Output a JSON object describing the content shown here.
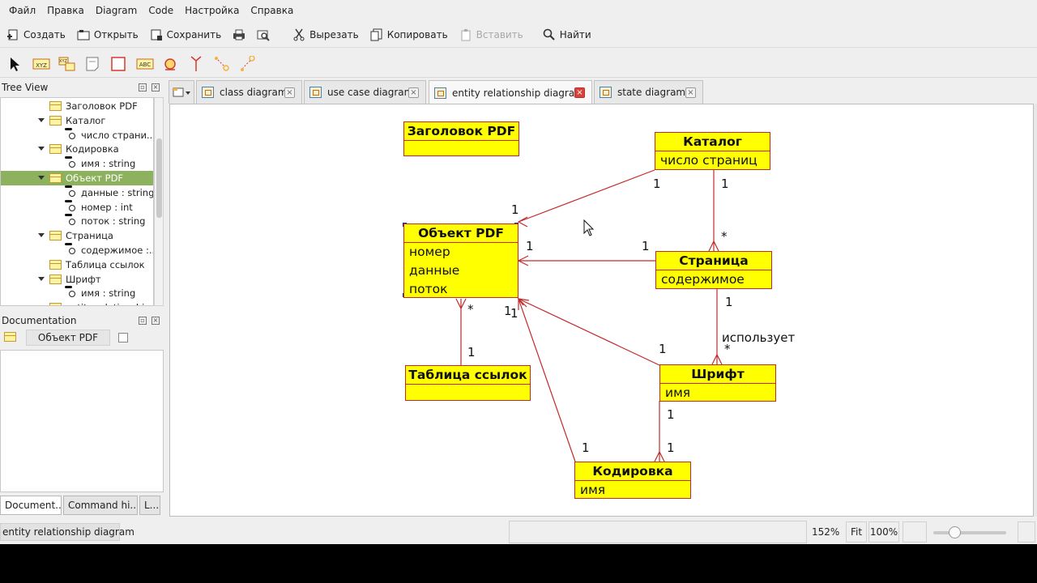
{
  "menubar": [
    "Файл",
    "Правка",
    "Diagram",
    "Code",
    "Настройка",
    "Справка"
  ],
  "toolbar": {
    "create": "Создать",
    "open": "Открыть",
    "save": "Сохранить",
    "cut": "Вырезать",
    "copy": "Копировать",
    "paste": "Вставить",
    "find": "Найти"
  },
  "treeview": {
    "title": "Tree View",
    "items": [
      {
        "label": "Заголовок PDF",
        "kind": "class"
      },
      {
        "label": "Каталог",
        "kind": "class"
      },
      {
        "label": "число страни...",
        "kind": "attribute"
      },
      {
        "label": "Кодировка",
        "kind": "class"
      },
      {
        "label": "имя : string",
        "kind": "attribute"
      },
      {
        "label": "Объект PDF",
        "kind": "class",
        "selected": true
      },
      {
        "label": "данные : string",
        "kind": "attribute"
      },
      {
        "label": "номер : int",
        "kind": "attribute"
      },
      {
        "label": "поток : string",
        "kind": "attribute"
      },
      {
        "label": "Страница",
        "kind": "class"
      },
      {
        "label": "содержимое :...",
        "kind": "attribute"
      },
      {
        "label": "Таблица ссылок",
        "kind": "class"
      },
      {
        "label": "Шрифт",
        "kind": "class"
      },
      {
        "label": "имя : string",
        "kind": "attribute"
      },
      {
        "label": "entity relationship...",
        "kind": "diagram"
      }
    ]
  },
  "documentation": {
    "title": "Documentation",
    "name_field": "Объект PDF",
    "tabs": [
      "Document...",
      "Command hi...",
      "L..."
    ]
  },
  "tabs": [
    {
      "label": "class diagram",
      "active": false
    },
    {
      "label": "use case diagram",
      "active": false
    },
    {
      "label": "entity relationship diagram",
      "active": true
    },
    {
      "label": "state diagram",
      "active": false
    }
  ],
  "diagram": {
    "entities": {
      "header_pdf": {
        "name": "Заголовок PDF",
        "attrs": []
      },
      "catalog": {
        "name": "Каталог",
        "attrs": [
          "число страниц"
        ]
      },
      "pdf_object": {
        "name": "Объект PDF",
        "attrs": [
          "номер",
          "данные",
          "поток"
        ]
      },
      "page": {
        "name": "Страница",
        "attrs": [
          "содержимое"
        ]
      },
      "xref_table": {
        "name": "Таблица ссылок",
        "attrs": []
      },
      "font": {
        "name": "Шрифт",
        "attrs": [
          "имя"
        ]
      },
      "encoding": {
        "name": "Кодировка",
        "attrs": [
          "имя"
        ]
      }
    },
    "multiplicities": {
      "obj_catalog": "1",
      "catalog_obj": "1",
      "catalog_top": "1",
      "page_catalog": "*",
      "obj_page": "1",
      "page_obj": "1",
      "page_bottom": "1",
      "font_page": "*",
      "uses": "использует",
      "obj_xref": "*",
      "xref_obj": "1",
      "obj_font_a": "1",
      "obj_font_b": "1",
      "font_obj": "1",
      "font_bottom": "1",
      "encoding_font": "1",
      "encoding_obj": "1"
    }
  },
  "statusbar": {
    "diagram_name": "entity relationship diagram",
    "zoom": "152%",
    "fit": "Fit",
    "zoom100": "100%",
    "zoom_slider_fraction": 0.25
  },
  "colors": {
    "entity_fill": "#ffff00",
    "entity_border": "#c22a2a",
    "tree_selection": "#8db25e",
    "tab_close_active": "#d9423a"
  }
}
